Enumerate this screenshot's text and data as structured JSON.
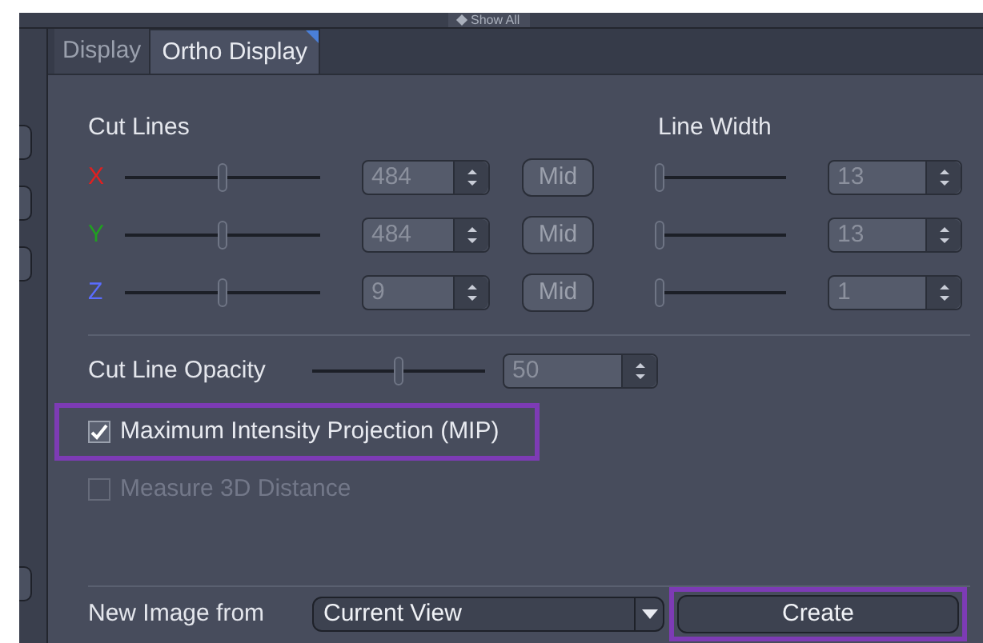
{
  "top_bar": {
    "label": "Show All"
  },
  "tabs": [
    {
      "label": "Display",
      "selected": false
    },
    {
      "label": "Ortho Display",
      "selected": true
    }
  ],
  "cut_lines": {
    "title": "Cut Lines",
    "line_width_title": "Line Width",
    "rows": [
      {
        "axis": "X",
        "color": "#e02020",
        "level": 0.5,
        "value": "484",
        "mid": "Mid",
        "width": {
          "level": 0,
          "value": "13"
        }
      },
      {
        "axis": "Y",
        "color": "#20a020",
        "level": 0.5,
        "value": "484",
        "mid": "Mid",
        "width": {
          "level": 0,
          "value": "13"
        }
      },
      {
        "axis": "Z",
        "color": "#5a6cff",
        "level": 0.5,
        "value": "9",
        "mid": "Mid",
        "width": {
          "level": 0,
          "value": "1"
        }
      }
    ]
  },
  "opacity": {
    "label": "Cut Line Opacity",
    "level": 0.5,
    "value": "50"
  },
  "checkboxes": [
    {
      "label": "Maximum Intensity Projection (MIP)",
      "checked": true,
      "disabled": false,
      "highlighted": true
    },
    {
      "label": "Measure 3D Distance",
      "checked": false,
      "disabled": true,
      "highlighted": false
    }
  ],
  "new_image": {
    "label": "New Image from",
    "value": "Current View",
    "button": "Create",
    "button_highlighted": true
  }
}
